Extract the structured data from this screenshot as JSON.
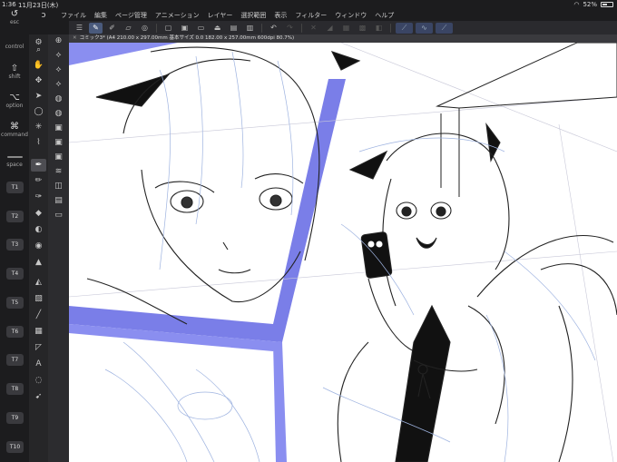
{
  "status": {
    "time": "1:36",
    "date": "11月23日(木)",
    "battery": "52%"
  },
  "menu": [
    "ファイル",
    "編集",
    "ページ管理",
    "アニメーション",
    "レイヤー",
    "選択範囲",
    "表示",
    "フィルター",
    "ウィンドウ",
    "ヘルプ"
  ],
  "modifiers": {
    "esc": "esc",
    "control": "control",
    "shift": "shift",
    "option": "option",
    "command": "command",
    "space": "space",
    "keys": [
      "T1",
      "T2",
      "T3",
      "T4",
      "T5",
      "T6",
      "T7",
      "T8",
      "T9",
      "T10"
    ]
  },
  "document": {
    "tab_title": "コミック3* (A4 210.00 x 297.00mm 基本サイズ 0.0 182.00 x 257.00mm 600dpi 80.7%)"
  },
  "icons": {
    "logo": "clip-studio-icon",
    "wifi": "wifi-icon"
  },
  "colors": {
    "foreground": "#e8b8a8",
    "background": "#111111",
    "accent": "#4a5a7c",
    "panel_border": "#7a7ee8"
  }
}
